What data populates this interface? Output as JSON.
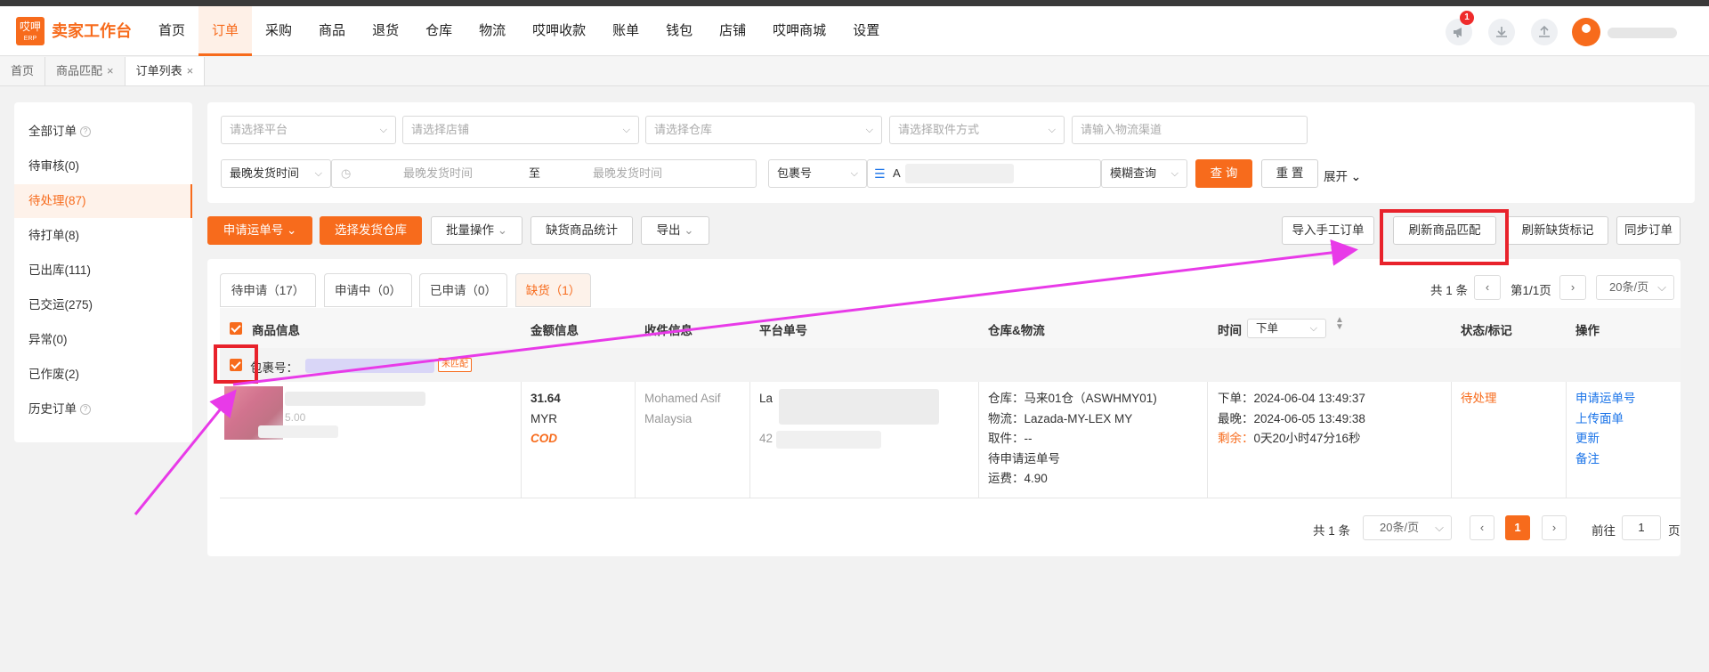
{
  "logo": {
    "glyph": "哎呷",
    "sub": "ERP",
    "title": "卖家工作台"
  },
  "menu": [
    "首页",
    "订单",
    "采购",
    "商品",
    "退货",
    "仓库",
    "物流",
    "哎呷收款",
    "账单",
    "钱包",
    "店铺",
    "哎呷商城",
    "设置"
  ],
  "notification_count": "1",
  "page_tabs": [
    {
      "label": "首页"
    },
    {
      "label": "商品匹配",
      "close": "×"
    },
    {
      "label": "订单列表",
      "close": "×"
    }
  ],
  "sidebar": [
    {
      "label": "全部订单",
      "help": "?"
    },
    {
      "label": "待审核(0)"
    },
    {
      "label": "待处理(87)"
    },
    {
      "label": "待打单(8)"
    },
    {
      "label": "已出库(111)"
    },
    {
      "label": "已交运(275)"
    },
    {
      "label": "异常(0)"
    },
    {
      "label": "已作废(2)"
    },
    {
      "label": "历史订单",
      "help": "?"
    }
  ],
  "filters": {
    "platform": "请选择平台",
    "shop": "请选择店铺",
    "warehouse": "请选择仓库",
    "pickup": "请选择取件方式",
    "channel": "请输入物流渠道",
    "time_type": "最晚发货时间",
    "date_start": "最晚发货时间",
    "date_sep": "至",
    "date_end": "最晚发货时间",
    "search_field": "包裹号",
    "search_value": "A",
    "match_mode": "模糊查询",
    "query": "查 询",
    "reset": "重 置",
    "expand": "展开"
  },
  "actions_left": [
    "申请运单号",
    "选择发货仓库",
    "批量操作",
    "缺货商品统计",
    "导出"
  ],
  "actions_right": [
    "导入手工订单",
    "刷新商品匹配",
    "刷新缺货标记",
    "同步订单"
  ],
  "sub_tabs": [
    "待申请（17）",
    "申请中（0）",
    "已申请（0）",
    "缺货（1）"
  ],
  "top_pagination": {
    "total": "共 1 条",
    "page": "第1/1页",
    "size": "20条/页"
  },
  "columns": [
    "商品信息",
    "金额信息",
    "收件信息",
    "平台单号",
    "仓库&物流",
    "时间",
    "下单",
    "状态/标记",
    "操作"
  ],
  "package_label": "包裹号：",
  "package_tag": "未匹配",
  "row": {
    "product_sub": "5.00",
    "amount": "31.64",
    "currency": "MYR",
    "payment": "COD",
    "recipient_name": "Mohamed Asif",
    "recipient_country": "Malaysia",
    "platform_prefix": "La",
    "platform_digits": "42",
    "warehouse": "仓库：马来01仓（ASWHMY01)",
    "logistics": "物流：Lazada-MY-LEX MY",
    "pickup": "取件：--",
    "waybill": "待申请运单号",
    "freight": "运费：4.90",
    "order_time": "下单：2024-06-04 13:49:37",
    "latest_time": "最晚：2024-06-05 13:49:38",
    "remain_label": "剩余：",
    "remain_value": "0天20小时47分16秒",
    "status": "待处理",
    "ops": [
      "申请运单号",
      "上传面单",
      "更新",
      "备注"
    ]
  },
  "bottom_pagination": {
    "total": "共 1 条",
    "size": "20条/页",
    "current": "1",
    "goto": "前往",
    "goto_value": "1",
    "unit": "页"
  },
  "colors": {
    "accent": "#f76b1c",
    "link": "#1a73e8",
    "annotation_red": "#e8222b",
    "annotation_magenta": "#e83ae8"
  }
}
